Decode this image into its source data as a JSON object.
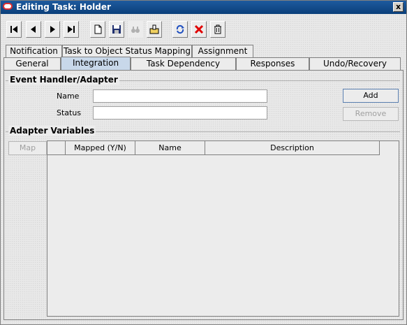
{
  "window": {
    "title": "Editing Task: Holder",
    "close_glyph": "x"
  },
  "toolbar": {
    "buttons": [
      {
        "name": "first-record-button",
        "icon": "first-icon"
      },
      {
        "name": "previous-record-button",
        "icon": "previous-icon"
      },
      {
        "name": "next-record-button",
        "icon": "next-icon"
      },
      {
        "name": "last-record-button",
        "icon": "last-icon"
      },
      {
        "name": "new-button",
        "icon": "new-document-icon"
      },
      {
        "name": "save-button",
        "icon": "save-icon"
      },
      {
        "name": "find-button",
        "icon": "binoculars-icon"
      },
      {
        "name": "assign-button",
        "icon": "assign-icon"
      },
      {
        "name": "refresh-button",
        "icon": "refresh-icon"
      },
      {
        "name": "delete-button",
        "icon": "delete-icon"
      },
      {
        "name": "trash-button",
        "icon": "trash-icon"
      }
    ]
  },
  "tabs": {
    "row1": [
      "Notification",
      "Task to Object Status Mapping",
      "Assignment"
    ],
    "row2": [
      "General",
      "Integration",
      "Task Dependency",
      "Responses",
      "Undo/Recovery"
    ],
    "active": "Integration"
  },
  "event_handler": {
    "title": "Event Handler/Adapter",
    "name_label": "Name",
    "name_value": "",
    "status_label": "Status",
    "status_value": "",
    "add_label": "Add",
    "remove_label": "Remove"
  },
  "adapter_variables": {
    "title": "Adapter Variables",
    "map_label": "Map",
    "columns": [
      "",
      "Mapped (Y/N)",
      "Name",
      "Description"
    ]
  },
  "colors": {
    "title_bar": "#0a3f7a",
    "active_tab": "#c8d8ea",
    "delete_icon": "#e00000"
  }
}
